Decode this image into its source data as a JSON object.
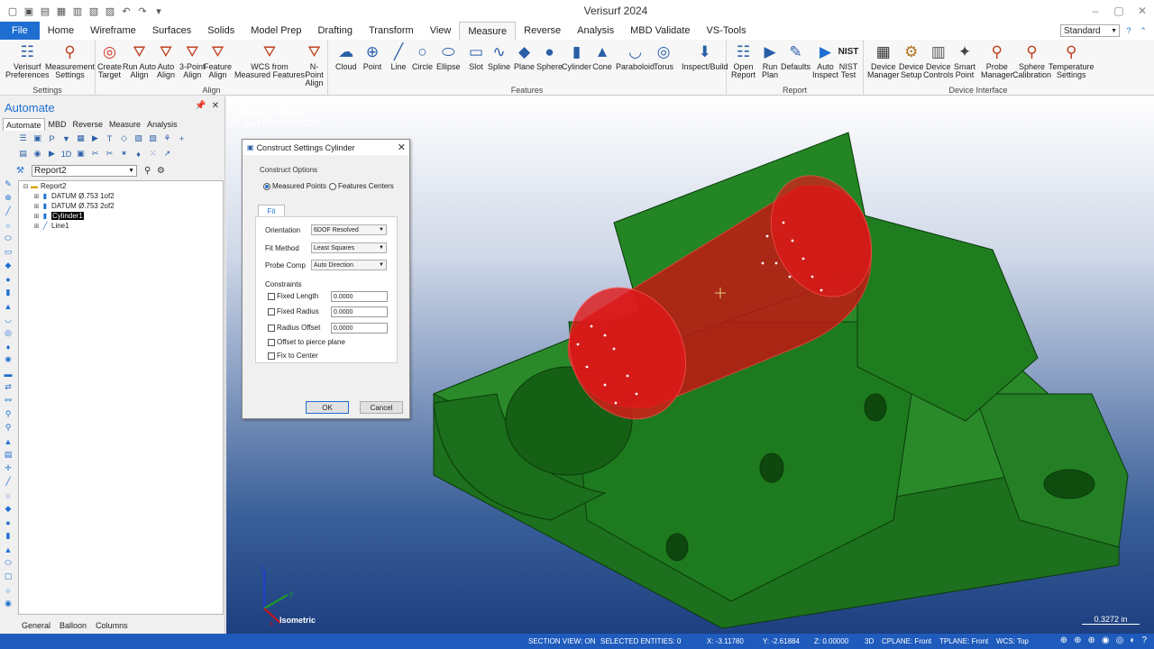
{
  "window": {
    "title": "Verisurf 2024"
  },
  "menu": {
    "tabs": [
      "File",
      "Home",
      "Wireframe",
      "Surfaces",
      "Solids",
      "Model Prep",
      "Drafting",
      "Transform",
      "View",
      "Measure",
      "Reverse",
      "Analysis",
      "MBD Validate",
      "VS-Tools"
    ],
    "active": "Measure",
    "style_combo": "Standard"
  },
  "ribbon": {
    "groups": [
      {
        "label": "Settings",
        "buttons": [
          {
            "label1": "Verisurf",
            "label2": "Preferences",
            "icon": "preferences-icon"
          },
          {
            "label1": "Measurement",
            "label2": "Settings",
            "icon": "measurement-settings-icon"
          }
        ]
      },
      {
        "label": "Align",
        "buttons": [
          {
            "label1": "Create",
            "label2": "Target",
            "icon": "target-icon"
          },
          {
            "label1": "Run Auto",
            "label2": "Align",
            "icon": "run-align-icon"
          },
          {
            "label1": "Auto",
            "label2": "Align",
            "icon": "auto-align-icon"
          },
          {
            "label1": "3-Point",
            "label2": "Align",
            "icon": "three-point-align-icon"
          },
          {
            "label1": "Feature",
            "label2": "Align",
            "icon": "feature-align-icon"
          },
          {
            "label1": "WCS from",
            "label2": "Measured Features",
            "icon": "wcs-icon"
          },
          {
            "label1": "N-Point",
            "label2": "Align",
            "icon": "n-point-align-icon"
          }
        ]
      },
      {
        "label": "Features",
        "buttons": [
          {
            "label1": "Cloud",
            "label2": "",
            "icon": "cloud-icon"
          },
          {
            "label1": "Point",
            "label2": "",
            "icon": "point-icon"
          },
          {
            "label1": "Line",
            "label2": "",
            "icon": "line-icon"
          },
          {
            "label1": "Circle",
            "label2": "",
            "icon": "circle-icon"
          },
          {
            "label1": "Ellipse",
            "label2": "",
            "icon": "ellipse-icon"
          },
          {
            "label1": "Slot",
            "label2": "",
            "icon": "slot-icon"
          },
          {
            "label1": "Spline",
            "label2": "",
            "icon": "spline-icon"
          },
          {
            "label1": "Plane",
            "label2": "",
            "icon": "plane-icon"
          },
          {
            "label1": "Sphere",
            "label2": "",
            "icon": "sphere-icon"
          },
          {
            "label1": "Cylinder",
            "label2": "",
            "icon": "cylinder-icon"
          },
          {
            "label1": "Cone",
            "label2": "",
            "icon": "cone-icon"
          },
          {
            "label1": "Paraboloid",
            "label2": "",
            "icon": "paraboloid-icon"
          },
          {
            "label1": "Torus",
            "label2": "",
            "icon": "torus-icon"
          },
          {
            "label1": "Inspect/Build",
            "label2": "",
            "icon": "inspect-build-icon"
          }
        ]
      },
      {
        "label": "Report",
        "buttons": [
          {
            "label1": "Open",
            "label2": "Report",
            "icon": "open-report-icon"
          },
          {
            "label1": "Run",
            "label2": "Plan",
            "icon": "run-plan-icon"
          },
          {
            "label1": "Defaults",
            "label2": "",
            "icon": "defaults-icon"
          },
          {
            "label1": "Auto",
            "label2": "Inspect",
            "icon": "auto-inspect-icon"
          },
          {
            "label1": "NIST",
            "label2": "Test",
            "icon": "nist-icon"
          }
        ]
      },
      {
        "label": "Device Interface",
        "buttons": [
          {
            "label1": "Device",
            "label2": "Manager",
            "icon": "device-manager-icon"
          },
          {
            "label1": "Device",
            "label2": "Setup",
            "icon": "device-setup-icon"
          },
          {
            "label1": "Device",
            "label2": "Controls",
            "icon": "device-controls-icon"
          },
          {
            "label1": "Smart",
            "label2": "Point",
            "icon": "smart-point-icon"
          },
          {
            "label1": "Probe",
            "label2": "Manager",
            "icon": "probe-manager-icon"
          },
          {
            "label1": "Sphere",
            "label2": "Calibration",
            "icon": "sphere-calibration-icon"
          },
          {
            "label1": "Temperature",
            "label2": "Settings",
            "icon": "temperature-icon"
          }
        ]
      }
    ]
  },
  "panel": {
    "title": "Automate",
    "tabs": [
      "Automate",
      "MBD",
      "Reverse",
      "Measure",
      "Analysis"
    ],
    "report_select": "Report2",
    "tree": [
      {
        "label": "Report2",
        "level": 0,
        "icon": "folder-icon"
      },
      {
        "label": "DATUM Ø.753 1of2",
        "level": 1,
        "icon": "datum-icon"
      },
      {
        "label": "DATUM Ø.753 2of2",
        "level": 1,
        "icon": "datum-icon"
      },
      {
        "label": "Cylinder1",
        "level": 1,
        "icon": "cylinder-icon",
        "selected": true
      },
      {
        "label": "Line1",
        "level": 1,
        "icon": "line-icon"
      }
    ],
    "bottom_tabs": [
      "General",
      "Balloon",
      "Columns"
    ]
  },
  "viewport": {
    "info_lines": [
      "Report: \"Report2\"",
      "Contains 4 items",
      "Output Format: PDF"
    ],
    "view_name": "Isometric",
    "scale_label": "0.3272 in"
  },
  "dialog": {
    "title": "Construct Settings Cylinder",
    "construct_options": "Construct Options",
    "radio_measured": "Measured Points",
    "radio_centers": "Features Centers",
    "fit_tab": "Fit",
    "orientation_label": "Orientation",
    "orientation_value": "6DOF Resolved",
    "fit_method_label": "Fit Method",
    "fit_method_value": "Least Squares",
    "probe_comp_label": "Probe Comp",
    "probe_comp_value": "Auto Direction",
    "constraints_label": "Constraints",
    "fixed_length_label": "Fixed Length",
    "fixed_length_value": "0.0000",
    "fixed_radius_label": "Fixed Radius",
    "fixed_radius_value": "0.0000",
    "radius_offset_label": "Radius Offset",
    "radius_offset_value": "0.0000",
    "offset_pierce_label": "Offset to pierce plane",
    "fix_center_label": "Fix to Center",
    "ok": "OK",
    "cancel": "Cancel"
  },
  "status": {
    "section_view": "SECTION VIEW: ON",
    "selected": "SELECTED ENTITIES: 0",
    "x": "X:  -3.11780",
    "y": "Y:  -2.61884",
    "z": "Z:  0.00000",
    "mode": "3D",
    "cplane": "CPLANE: Front",
    "tplane": "TPLANE: Front",
    "wcs": "WCS: Top"
  },
  "colors": {
    "accent": "#1e6fd1",
    "statusbar": "#1e5bbd",
    "part_green": "#1f7a1f",
    "cylinder_red": "#e01010"
  }
}
